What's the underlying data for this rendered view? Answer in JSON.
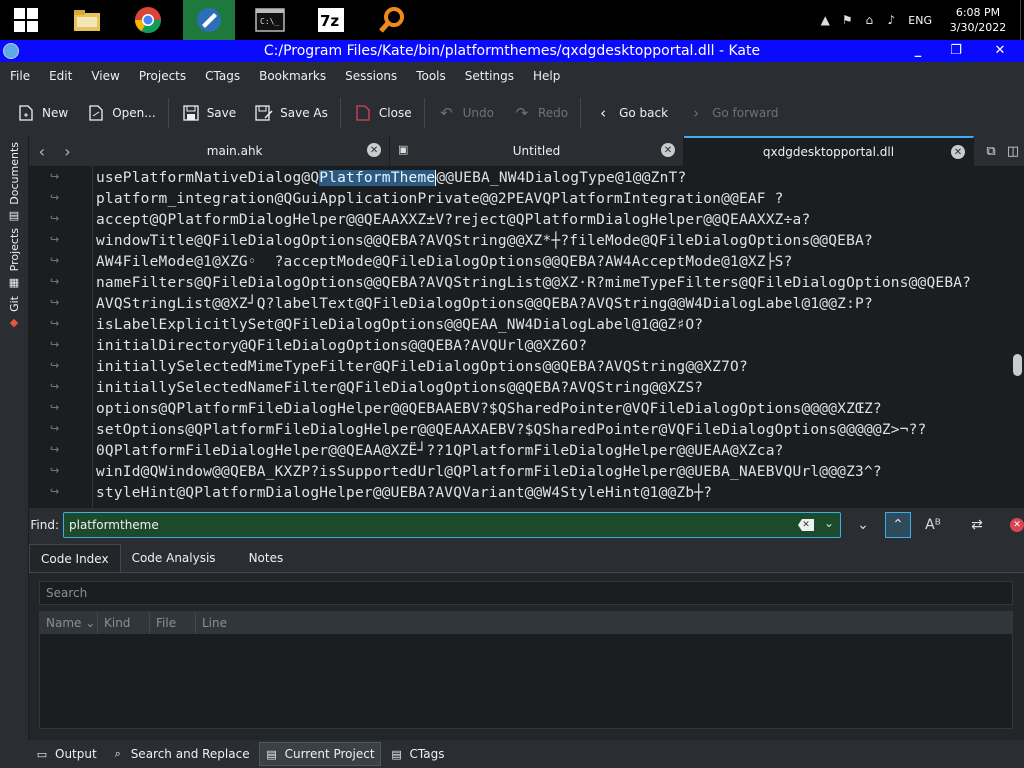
{
  "taskbar": {
    "apps": [
      {
        "name": "windows-start-icon",
        "icon": "⊞"
      },
      {
        "name": "file-explorer-icon",
        "icon": "📁"
      },
      {
        "name": "chrome-icon",
        "icon": "◉"
      },
      {
        "name": "kate-taskbar-icon",
        "icon": "✎"
      },
      {
        "name": "terminal-icon",
        "icon": "▭"
      },
      {
        "name": "7zip-icon",
        "icon": "7z"
      },
      {
        "name": "search-app-icon",
        "icon": "🔍"
      }
    ],
    "tray_icons": [
      "▲",
      "⚑",
      "🖧",
      "🔇"
    ],
    "lang": "ENG",
    "time": "6:08 PM",
    "date": "3/30/2022"
  },
  "window": {
    "title": "C:/Program Files/Kate/bin/platformthemes/qxdgdesktopportal.dll - Kate",
    "minimize": "_",
    "maximize": "❐",
    "close": "✕"
  },
  "menu": [
    "File",
    "Edit",
    "View",
    "Projects",
    "CTags",
    "Bookmarks",
    "Sessions",
    "Tools",
    "Settings",
    "Help"
  ],
  "toolbar": {
    "new": "New",
    "open": "Open...",
    "save": "Save",
    "save_as": "Save As",
    "close": "Close",
    "undo": "Undo",
    "redo": "Redo",
    "go_back": "Go back",
    "go_forward": "Go forward"
  },
  "sidebar": {
    "documents": "Documents",
    "projects": "Projects",
    "git": "Git"
  },
  "tabs": [
    {
      "label": "main.ahk",
      "active": false
    },
    {
      "label": "Untitled",
      "active": false
    },
    {
      "label": "qxdgdesktopportal.dll",
      "active": true
    }
  ],
  "editor": {
    "lines": [
      {
        "pre": "usePlatformNativeDialog@Q",
        "match": "PlatformTheme",
        "post": "@@UEBA_NW4DialogType@1@@ZnT?"
      },
      {
        "pre": "platform_integration@QGuiApplicationPrivate@@2PEAVQPlatformIntegration@@EAF ?"
      },
      {
        "pre": "accept@QPlatformDialogHelper@@QEAAXXZ±V?reject@QPlatformDialogHelper@@QEAAXXZ÷a?"
      },
      {
        "pre": "windowTitle@QFileDialogOptions@@QEBA?AVQString@@XZ*┼?fileMode@QFileDialogOptions@@QEBA?"
      },
      {
        "pre": "AW4FileMode@1@XZG◦  ?acceptMode@QFileDialogOptions@@QEBA?AW4AcceptMode@1@XZ├S?"
      },
      {
        "pre": "nameFilters@QFileDialogOptions@@QEBA?AVQStringList@@XZ·R?mimeTypeFilters@QFileDialogOptions@@QEBA?"
      },
      {
        "pre": "AVQStringList@@XZ┘Q?labelText@QFileDialogOptions@@QEBA?AVQString@@W4DialogLabel@1@@Z:P?"
      },
      {
        "pre": "isLabelExplicitlySet@QFileDialogOptions@@QEAA_NW4DialogLabel@1@@Z♯O?"
      },
      {
        "pre": "initialDirectory@QFileDialogOptions@@QEBA?AVQUrl@@XZ6O?"
      },
      {
        "pre": "initiallySelectedMimeTypeFilter@QFileDialogOptions@@QEBA?AVQString@@XZ7O?"
      },
      {
        "pre": "initiallySelectedNameFilter@QFileDialogOptions@@QEBA?AVQString@@XZS?"
      },
      {
        "pre": "options@QPlatformFileDialogHelper@@QEBAAEBV?$QSharedPointer@VQFileDialogOptions@@@@XZŒZ?"
      },
      {
        "pre": "setOptions@QPlatformFileDialogHelper@@QEAAXAEBV?$QSharedPointer@VQFileDialogOptions@@@@@Z>¬??"
      },
      {
        "pre": "0QPlatformFileDialogHelper@@QEAA@XZË┘??1QPlatformFileDialogHelper@@UEAA@XZca?"
      },
      {
        "pre": "winId@QWindow@@QEBA_KXZP?isSupportedUrl@QPlatformFileDialogHelper@@UEBA_NAEBVQUrl@@@Z3^?"
      },
      {
        "pre": "styleHint@QPlatformDialogHelper@@UEBA?AVQVariant@@W4StyleHint@1@@Zb┼?"
      }
    ]
  },
  "find": {
    "label": "Find:",
    "value": "platformtheme"
  },
  "bottom_panel": {
    "tabs": [
      "Code Index",
      "Code Analysis",
      "Notes"
    ],
    "search_placeholder": "Search",
    "columns": [
      "Name",
      "Kind",
      "File",
      "Line"
    ]
  },
  "statusbar": {
    "buttons": [
      {
        "label": "Output",
        "icon": "▭",
        "active": false
      },
      {
        "label": "Search and Replace",
        "icon": "⌕",
        "active": false
      },
      {
        "label": "Current Project",
        "icon": "▤",
        "active": true
      },
      {
        "label": "CTags",
        "icon": "▤",
        "active": false
      }
    ]
  },
  "colors": {
    "titlebar": "#0a0aff",
    "accent": "#3daee9",
    "find_bg": "#1e4a2c",
    "match_highlight": "#2d5a80",
    "taskbar_active": "#1e7a3c"
  }
}
